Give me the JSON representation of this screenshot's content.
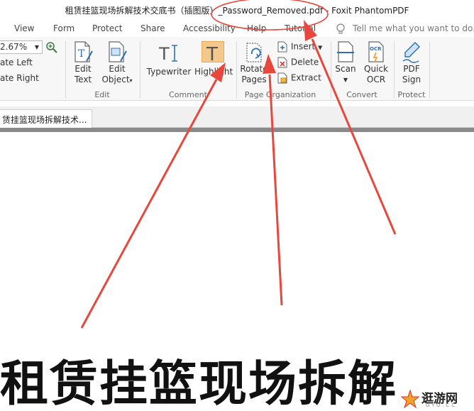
{
  "window": {
    "title": "租赁挂篮现场拆解技术交底书（插图版）_Password_Removed.pdf - Foxit PhantomPDF"
  },
  "menu": {
    "items": [
      "View",
      "Form",
      "Protect",
      "Share",
      "Accessibility",
      "Help",
      "Tutorial"
    ],
    "tell_me_placeholder": "Tell me what you want to do..."
  },
  "ribbon": {
    "zoom_value": "2.67%",
    "rotate_left": "ate Left",
    "rotate_right": "ate Right",
    "edit_text": [
      "Edit",
      "Text"
    ],
    "edit_object": [
      "Edit",
      "Object"
    ],
    "edit_group": "Edit",
    "typewriter": "Typewriter",
    "highlight": "Highlight",
    "comment_group": "Comment",
    "rotate_pages": [
      "Rotate",
      "Pages"
    ],
    "insert": "Insert",
    "delete": "Delete",
    "extract": "Extract",
    "page_org_group": "Page Organization",
    "scan": "Scan",
    "quick_ocr": [
      "Quick",
      "OCR"
    ],
    "convert_group": "Convert",
    "pdf_sign": [
      "PDF",
      "Sign"
    ],
    "protect_group": "Protect"
  },
  "document": {
    "tab_label": "赁挂篮现场拆解技术...",
    "heading": "租赁挂篮现场拆解"
  },
  "watermark": {
    "text": "逛游网",
    "sub": "GYO.CC"
  },
  "colors": {
    "annotation_red": "#e8473d",
    "highlight_orange": "#f4c78a",
    "icon_blue": "#2f6db3"
  }
}
